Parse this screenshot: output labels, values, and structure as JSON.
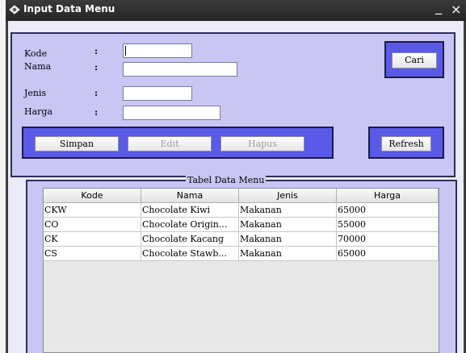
{
  "window": {
    "title": "Input Data Menu",
    "minimize": "_",
    "close": "×"
  },
  "form": {
    "kode": {
      "label": "Kode",
      "colon": ":",
      "value": ""
    },
    "nama": {
      "label": "Nama",
      "colon": ":",
      "value": ""
    },
    "jenis": {
      "label": "Jenis",
      "colon": ":",
      "value": ""
    },
    "harga": {
      "label": "Harga",
      "colon": ":",
      "value": ""
    },
    "cari_label": "Cari",
    "simpan_label": "Simpan",
    "edit_label": "Edit",
    "hapus_label": "Hapus",
    "refresh_label": "Refresh"
  },
  "table": {
    "legend": "Tabel Data Menu",
    "headers": [
      "Kode",
      "Nama",
      "Jenis",
      "Harga"
    ],
    "rows": [
      [
        "CKW",
        "Chocolate Kiwi",
        "Makanan",
        "65000"
      ],
      [
        "CO",
        "Chocolate Origin...",
        "Makanan",
        "55000"
      ],
      [
        "CK",
        "Chocolate Kacang",
        "Makanan",
        "70000"
      ],
      [
        "CS",
        "Chocolate Stawb...",
        "Makanan",
        "65000"
      ]
    ]
  },
  "colors": {
    "panel": "#c9c6f4",
    "button_box": "#5a5ae8",
    "titlebar": "#2f2f2f"
  }
}
